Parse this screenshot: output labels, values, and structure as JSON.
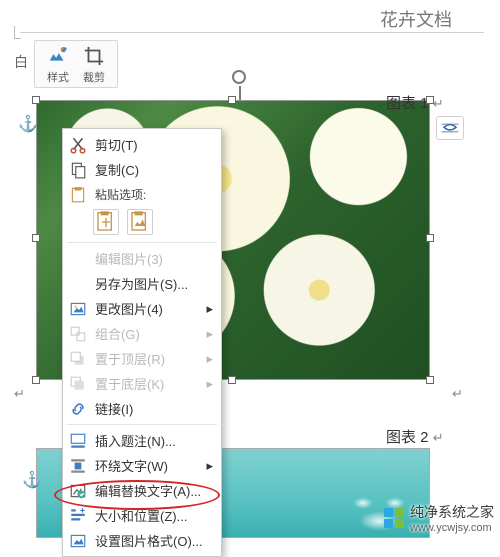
{
  "doc_title": "花卉文档",
  "ribbon": {
    "bg_label": "白",
    "style_label": "样式",
    "crop_label": "裁剪"
  },
  "captions": {
    "c1": "图表 1",
    "c2": "图表 2",
    "mark": "↵"
  },
  "context_menu": {
    "cut": "剪切(T)",
    "copy": "复制(C)",
    "paste_header": "粘贴选项:",
    "edit_pic": "编辑图片(3)",
    "save_as_pic": "另存为图片(S)...",
    "change_pic": "更改图片(4)",
    "group": "组合(G)",
    "bring_front": "置于顶层(R)",
    "send_back": "置于底层(K)",
    "link": "链接(I)",
    "insert_caption": "插入题注(N)...",
    "wrap_text": "环绕文字(W)",
    "alt_text": "编辑替换文字(A)...",
    "size_pos": "大小和位置(Z)...",
    "format_pic": "设置图片格式(O)..."
  },
  "watermark": {
    "name": "纯净系统之家",
    "link": "www.ycwjsy.com"
  }
}
